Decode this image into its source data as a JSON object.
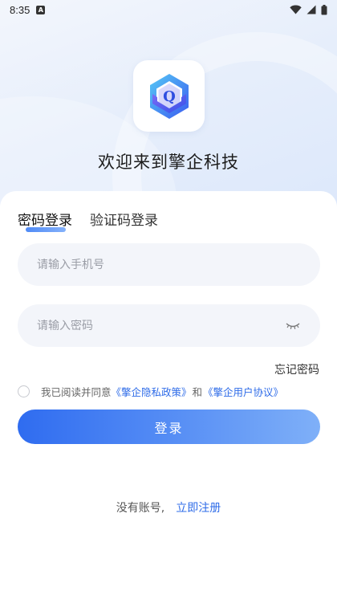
{
  "status_bar": {
    "time": "8:35",
    "notification_glyph": "A",
    "icons": [
      "wifi-icon",
      "cellular-signal-icon",
      "battery-icon"
    ]
  },
  "app": {
    "logo_icon": "qiye-hexagon-q-logo",
    "welcome_text": "欢迎来到擎企科技"
  },
  "tabs": [
    {
      "label": "密码登录",
      "active": true
    },
    {
      "label": "验证码登录",
      "active": false
    }
  ],
  "form": {
    "phone_placeholder": "请输入手机号",
    "password_placeholder": "请输入密码",
    "password_toggle_icon": "eye-closed-icon",
    "forgot_password": "忘记密码"
  },
  "agreement": {
    "checked": false,
    "prefix": "我已阅读并同意",
    "privacy_link": "《擎企隐私政策》",
    "conjunction": "和",
    "user_agreement_link": "《擎企用户协议》"
  },
  "login_button": "登录",
  "register": {
    "prompt": "没有账号,",
    "link": "立即注册"
  },
  "colors": {
    "primary": "#2f6ce8",
    "button_gradient_start": "#2f6cf0",
    "button_gradient_end": "#7fb0f8",
    "input_background": "#f3f5fa"
  }
}
